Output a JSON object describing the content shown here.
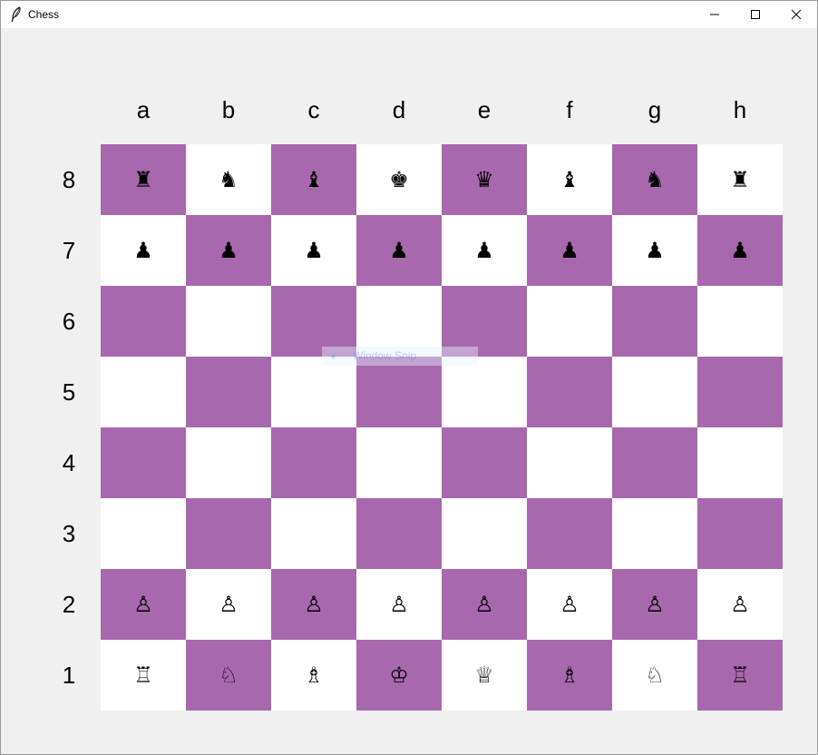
{
  "window": {
    "title": "Chess",
    "app_icon": "feather-icon",
    "controls": {
      "minimize": "minimize-icon",
      "maximize": "maximize-icon",
      "close": "close-icon"
    }
  },
  "board": {
    "files": [
      "a",
      "b",
      "c",
      "d",
      "e",
      "f",
      "g",
      "h"
    ],
    "ranks": [
      "8",
      "7",
      "6",
      "5",
      "4",
      "3",
      "2",
      "1"
    ],
    "colors": {
      "dark": "#a868ad",
      "light": "#ffffff"
    },
    "pieces": [
      [
        "♜",
        "♞",
        "♝",
        "♚",
        "♛",
        "♝",
        "♞",
        "♜"
      ],
      [
        "♟",
        "♟",
        "♟",
        "♟",
        "♟",
        "♟",
        "♟",
        "♟"
      ],
      [
        "",
        "",
        "",
        "",
        "",
        "",
        "",
        ""
      ],
      [
        "",
        "",
        "",
        "",
        "",
        "",
        "",
        ""
      ],
      [
        "",
        "",
        "",
        "",
        "",
        "",
        "",
        ""
      ],
      [
        "",
        "",
        "",
        "",
        "",
        "",
        "",
        ""
      ],
      [
        "♙",
        "♙",
        "♙",
        "♙",
        "♙",
        "♙",
        "♙",
        "♙"
      ],
      [
        "♖",
        "♘",
        "♗",
        "♔",
        "♕",
        "♗",
        "♘",
        "♖"
      ]
    ]
  },
  "overlay": {
    "snap_label": "Window Snip"
  }
}
